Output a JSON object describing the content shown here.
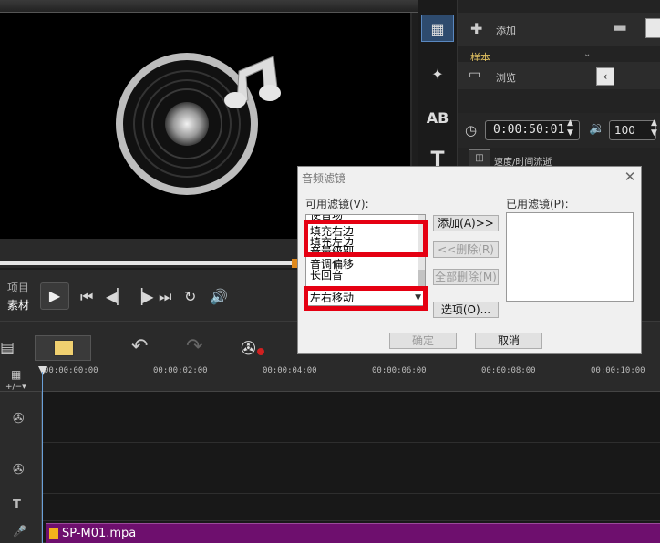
{
  "library": {
    "add_label": "添加",
    "browse_label": "浏览",
    "sample_tab": "样本",
    "timecode": "0:00:50:01",
    "volume": "100",
    "speed_label": "速度/时间流逝"
  },
  "preview": {
    "project_label": "项目",
    "clip_label": "素材"
  },
  "dialog": {
    "title": "音频滤镜",
    "available_label": "可用滤镜(V):",
    "applied_label": "已用滤镜(P):",
    "available_items": [
      "使音场",
      "填充右边",
      "填充左边",
      "音量级别",
      "音调偏移",
      "长回音",
      "左右移动"
    ],
    "selected_combo": "左右移动",
    "add_button": "添加(A)>>",
    "remove_button": "<<删除(R)",
    "remove_all_button": "全部删除(M)",
    "options_button": "选项(O)...",
    "ok_button": "确定",
    "cancel_button": "取消"
  },
  "timeline": {
    "ticks": [
      "00:00:00:00",
      "00:00:02:00",
      "00:00:04:00",
      "00:00:06:00",
      "00:00:08:00",
      "00:00:10:00"
    ],
    "audio_clip_name": "SP-M01.mpa"
  }
}
